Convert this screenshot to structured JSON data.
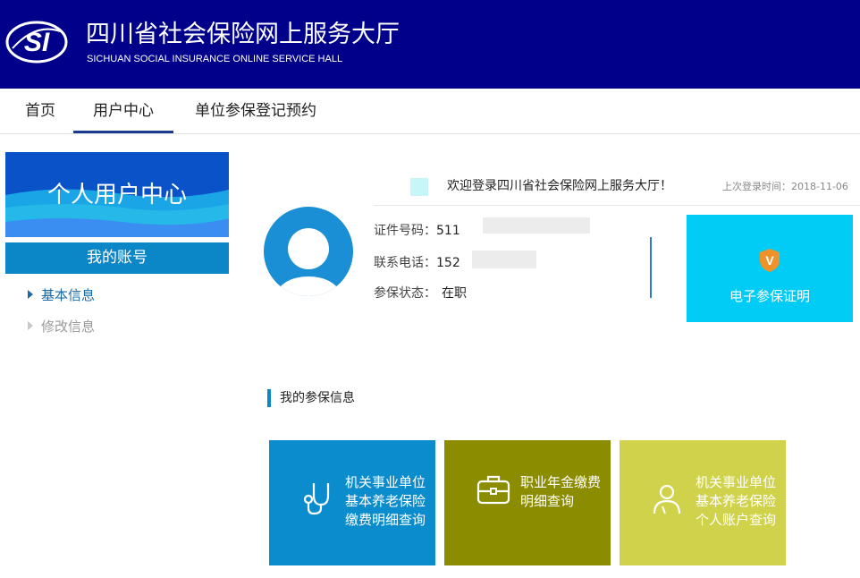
{
  "header": {
    "logo_text": "SI",
    "title": "四川省社会保险网上服务大厅",
    "subtitle": "SICHUAN SOCIAL INSURANCE ONLINE SERVICE HALL"
  },
  "nav": {
    "items": [
      {
        "label": "首页"
      },
      {
        "label": "用户中心",
        "active": true
      },
      {
        "label": "单位参保登记预约"
      }
    ]
  },
  "sidebar": {
    "banner_title": "个人用户中心",
    "account_title": "我的账号",
    "links": [
      {
        "label": "基本信息",
        "active": true
      },
      {
        "label": "修改信息",
        "active": false
      }
    ]
  },
  "welcome": {
    "message": "欢迎登录四川省社会保险网上服务大厅！",
    "last_login": "上次登录时间：2018-11-06"
  },
  "profile": {
    "id_label": "证件号码：",
    "id_value": "511",
    "phone_label": "联系电话：",
    "phone_value": "152",
    "status_label": "参保状态：",
    "status_value": "在职"
  },
  "cert": {
    "badge": "V",
    "label": "电子参保证明"
  },
  "section": {
    "title": "我的参保信息"
  },
  "tiles": [
    {
      "lines": [
        "机关事业单位",
        "基本养老保险",
        "缴费明细查询"
      ],
      "icon": "stethoscope-icon",
      "color": "#0b8ccc"
    },
    {
      "lines": [
        "职业年金缴费",
        "明细查询"
      ],
      "icon": "briefcase-icon",
      "color": "#8c8c00"
    },
    {
      "lines": [
        "机关事业单位",
        "基本养老保险",
        "个人账户查询"
      ],
      "icon": "person-icon",
      "color": "#cfd24a"
    }
  ],
  "colors": {
    "header_bg": "#00008b",
    "accent_blue": "#0b86c6",
    "cert_cyan": "#00ccf5"
  }
}
